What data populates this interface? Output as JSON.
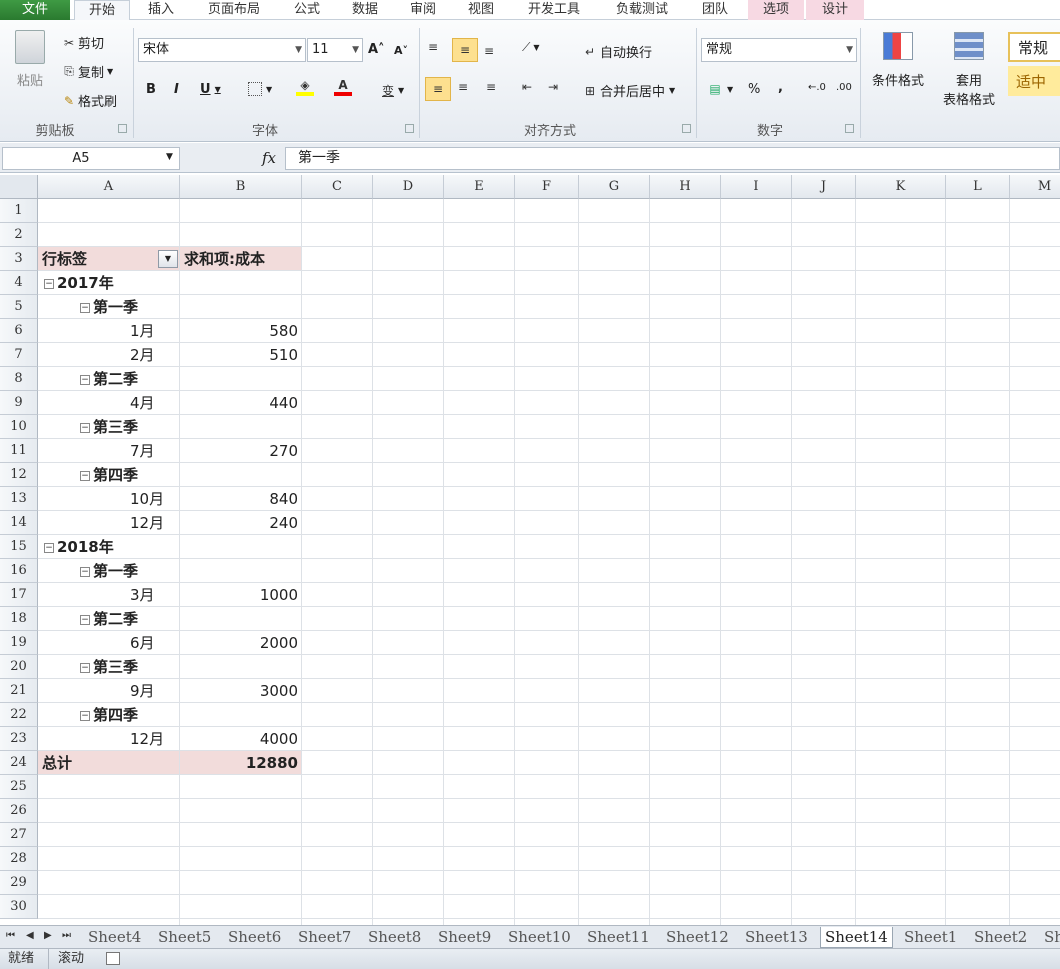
{
  "menu": {
    "file": "文件",
    "home": "开始",
    "insert": "插入",
    "page_layout": "页面布局",
    "formulas": "公式",
    "data": "数据",
    "review": "审阅",
    "view": "视图",
    "developer": "开发工具",
    "load_test": "负载测试",
    "team": "团队",
    "options": "选项",
    "design": "设计"
  },
  "ribbon": {
    "clipboard": {
      "paste": "粘贴",
      "cut": "剪切",
      "copy": "复制",
      "format_painter": "格式刷",
      "label": "剪贴板"
    },
    "font": {
      "name": "宋体",
      "size": "11",
      "label": "字体"
    },
    "alignment": {
      "wrap": "自动换行",
      "merge": "合并后居中",
      "label": "对齐方式"
    },
    "number": {
      "format": "常规",
      "percent": "%",
      "comma": ",",
      "label": "数字"
    },
    "styles": {
      "conditional": "条件格式",
      "table1": "套用",
      "table2": "表格格式",
      "normal": "常规",
      "neutral": "适中"
    }
  },
  "formula_bar": {
    "name_box": "A5",
    "fx": "fx",
    "value": "第一季"
  },
  "columns": [
    "A",
    "B",
    "C",
    "D",
    "E",
    "F",
    "G",
    "H",
    "I",
    "J",
    "K",
    "L",
    "M"
  ],
  "rows": [
    "1",
    "2",
    "3",
    "4",
    "5",
    "6",
    "7",
    "8",
    "9",
    "10",
    "11",
    "12",
    "13",
    "14",
    "15",
    "16",
    "17",
    "18",
    "19",
    "20",
    "21",
    "22",
    "23",
    "24",
    "25",
    "26",
    "27",
    "28",
    "29",
    "30"
  ],
  "pivot": {
    "row_label": "行标签",
    "value_header": "求和项:成本",
    "y2017": "2017年",
    "q1": "第一季",
    "q2": "第二季",
    "q3": "第三季",
    "q4": "第四季",
    "m1": "1月",
    "v1": "580",
    "m2": "2月",
    "v2": "510",
    "m4": "4月",
    "v4": "440",
    "m7": "7月",
    "v7": "270",
    "m10": "10月",
    "v10": "840",
    "m12": "12月",
    "v12": "240",
    "y2018": "2018年",
    "q1b": "第一季",
    "q2b": "第二季",
    "q3b": "第三季",
    "q4b": "第四季",
    "m3b": "3月",
    "v3b": "1000",
    "m6b": "6月",
    "v6b": "2000",
    "m9b": "9月",
    "v9b": "3000",
    "m12b": "12月",
    "v12b": "4000",
    "total_label": "总计",
    "total": "12880"
  },
  "sheets": [
    "Sheet4",
    "Sheet5",
    "Sheet6",
    "Sheet7",
    "Sheet8",
    "Sheet9",
    "Sheet10",
    "Sheet11",
    "Sheet12",
    "Sheet13",
    "Sheet14",
    "Sheet1",
    "Sheet2",
    "Sh"
  ],
  "active_sheet": "Sheet14",
  "status": {
    "ready": "就绪",
    "scroll": "滚动"
  }
}
